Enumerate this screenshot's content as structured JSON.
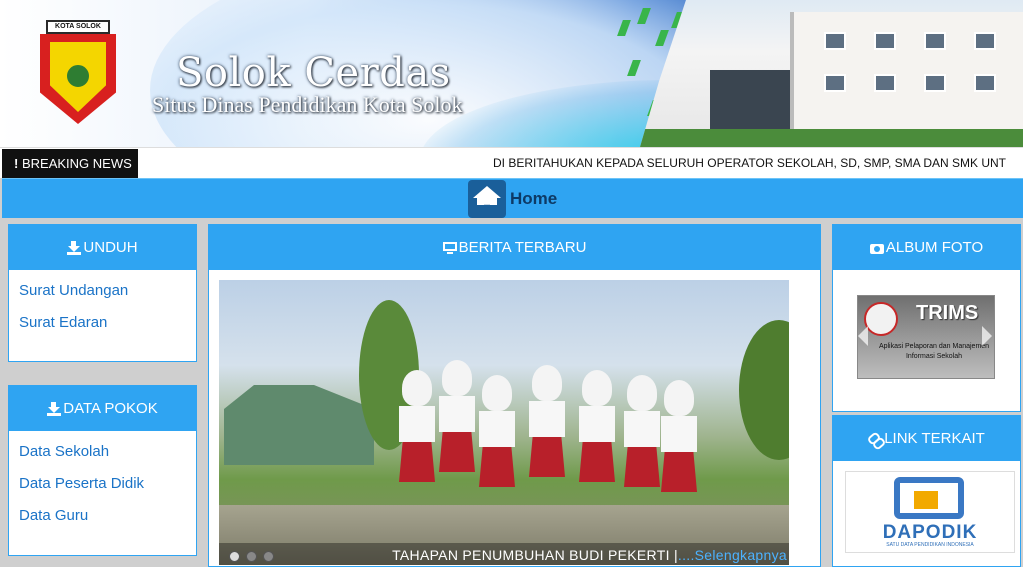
{
  "header": {
    "title": "Solok Cerdas",
    "subtitle": "Situs Dinas Pendidikan Kota Solok",
    "logo_text": "KOTA SOLOK"
  },
  "breaking_news": {
    "label": "BREAKING NEWS",
    "icon": "exclamation-icon",
    "ticker": "DI BERITAHUKAN KEPADA SELURUH OPERATOR SEKOLAH, SD, SMP, SMA DAN SMK UNT"
  },
  "nav": {
    "home_label": "Home",
    "home_icon": "home-icon"
  },
  "left": {
    "unduh": {
      "title": "UNDUH",
      "icon": "download-icon",
      "items": [
        {
          "label": "Surat Undangan"
        },
        {
          "label": "Surat Edaran"
        }
      ]
    },
    "data_pokok": {
      "title": "DATA POKOK",
      "icon": "download-icon",
      "items": [
        {
          "label": "Data Sekolah"
        },
        {
          "label": "Data Peserta Didik"
        },
        {
          "label": "Data Guru"
        }
      ]
    }
  },
  "center": {
    "title": "BERITA TERBARU",
    "icon": "monitor-icon",
    "slide": {
      "caption": "TAHAPAN PENUMBUHAN BUDI PEKERTI |",
      "more": "....Selengkapnya",
      "dots": 3,
      "active_dot": 0
    }
  },
  "right": {
    "album": {
      "title": "ALBUM FOTO",
      "icon": "camera-icon",
      "image_title": "TRIMS",
      "image_subtitle": "Aplikasi Pelaporan dan Manajemen Informasi Sekolah"
    },
    "links": {
      "title": "LINK TERKAIT",
      "icon": "link-icon",
      "banner": "DAPODIK",
      "banner_tag": "SATU DATA PENDIDIKAN INDONESIA"
    }
  },
  "colors": {
    "accent": "#2fa4f2",
    "link": "#1a73c7",
    "breaking_bg": "#111111",
    "page_bg": "#cfcfcf"
  }
}
